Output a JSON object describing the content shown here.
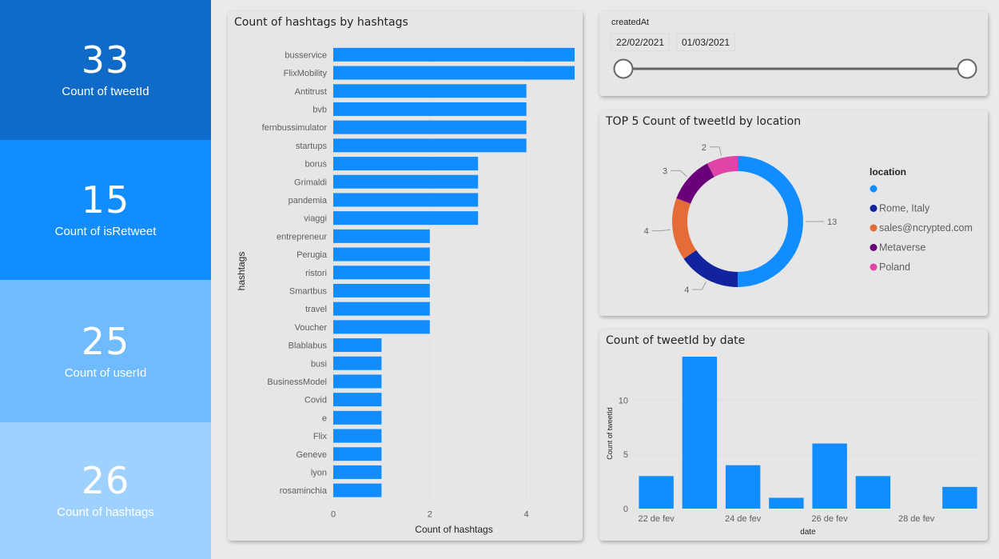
{
  "kpis": [
    {
      "value": "33",
      "label": "Count of tweetId",
      "bg": "#0f6bc7"
    },
    {
      "value": "15",
      "label": "Count of isRetweet",
      "bg": "#118dff"
    },
    {
      "value": "25",
      "label": "Count of userId",
      "bg": "#70bbff"
    },
    {
      "value": "26",
      "label": "Count of hashtags",
      "bg": "#9fd1ff"
    }
  ],
  "slicer": {
    "title": "createdAt",
    "start": "22/02/2021",
    "end": "01/03/2021"
  },
  "colors": {
    "bar": "#118dff",
    "grid": "#c8c8c8"
  },
  "chart_data": [
    {
      "type": "bar",
      "orientation": "horizontal",
      "title": "Count of hashtags by hashtags",
      "xlabel": "Count of hashtags",
      "ylabel": "hashtags",
      "xlim": [
        0,
        5
      ],
      "xticks": [
        0,
        2,
        4
      ],
      "grid": true,
      "categories": [
        "busservice",
        "FlixMobility",
        "Antitrust",
        "bvb",
        "fernbussimulator",
        "startups",
        "borus",
        "Grimaldi",
        "pandemia",
        "viaggi",
        "entrepreneur",
        "Perugia",
        "ristori",
        "Smartbus",
        "travel",
        "Voucher",
        "Blablabus",
        "busi",
        "BusinessModel",
        "Covid",
        "e",
        "Flix",
        "Geneve",
        "lyon",
        "rosaminchia"
      ],
      "values": [
        5,
        5,
        4,
        4,
        4,
        4,
        3,
        3,
        3,
        3,
        2,
        2,
        2,
        2,
        2,
        2,
        1,
        1,
        1,
        1,
        1,
        1,
        1,
        1,
        1
      ]
    },
    {
      "type": "pie",
      "variant": "donut",
      "title": "TOP 5 Count of tweetId by location",
      "legend_title": "location",
      "legend_position": "right",
      "slices": [
        {
          "label": "",
          "value": 13,
          "color": "#118dff"
        },
        {
          "label": "Rome, Italy",
          "value": 4,
          "color": "#12239e"
        },
        {
          "label": "sales@ncrypted.com",
          "value": 4,
          "color": "#e66c37"
        },
        {
          "label": "Metaverse",
          "value": 3,
          "color": "#6b007b"
        },
        {
          "label": "Poland",
          "value": 2,
          "color": "#e044a7"
        }
      ]
    },
    {
      "type": "bar",
      "orientation": "vertical",
      "title": "Count of tweetId by date",
      "xlabel": "date",
      "ylabel": "Count of tweetId",
      "ylim": [
        0,
        14
      ],
      "yticks": [
        0,
        5,
        10
      ],
      "grid": true,
      "x": [
        "22 de fev",
        "23 de fev",
        "24 de fev",
        "25 de fev",
        "26 de fev",
        "27 de fev",
        "28 de fev",
        "1 de mar"
      ],
      "values": [
        3,
        14,
        4,
        1,
        6,
        3,
        0,
        2
      ],
      "xtick_labels": [
        "22 de fev",
        "24 de fev",
        "26 de fev",
        "28 de fev"
      ]
    }
  ]
}
